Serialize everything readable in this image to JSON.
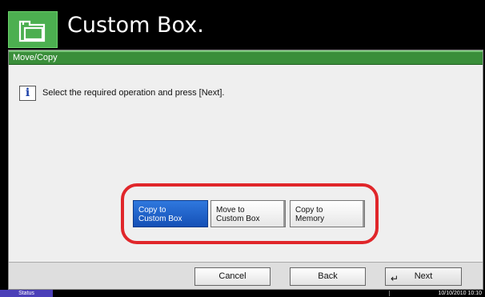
{
  "header": {
    "title": "Custom Box.",
    "icon": "boxes-icon"
  },
  "panel": {
    "title": "Move/Copy",
    "info_icon": "info-icon",
    "message": "Select the required operation and press [Next]."
  },
  "options": [
    {
      "line1": "Copy to",
      "line2": "Custom Box",
      "selected": true
    },
    {
      "line1": "Move to",
      "line2": "Custom Box",
      "selected": false
    },
    {
      "line1": "Copy to",
      "line2": "Memory",
      "selected": false
    }
  ],
  "buttons": {
    "cancel": "Cancel",
    "back": "Back",
    "next": "Next",
    "next_icon": "enter-icon"
  },
  "status": {
    "label": "Status",
    "datetime": "10/10/2010  10:10"
  },
  "colors": {
    "header_icon_bg": "#4caf50",
    "panel_title_bg": "#3a8e3a",
    "selected_option": "#1c5fc8",
    "highlight": "#e0262a",
    "status_button": "#4b3fb8"
  }
}
